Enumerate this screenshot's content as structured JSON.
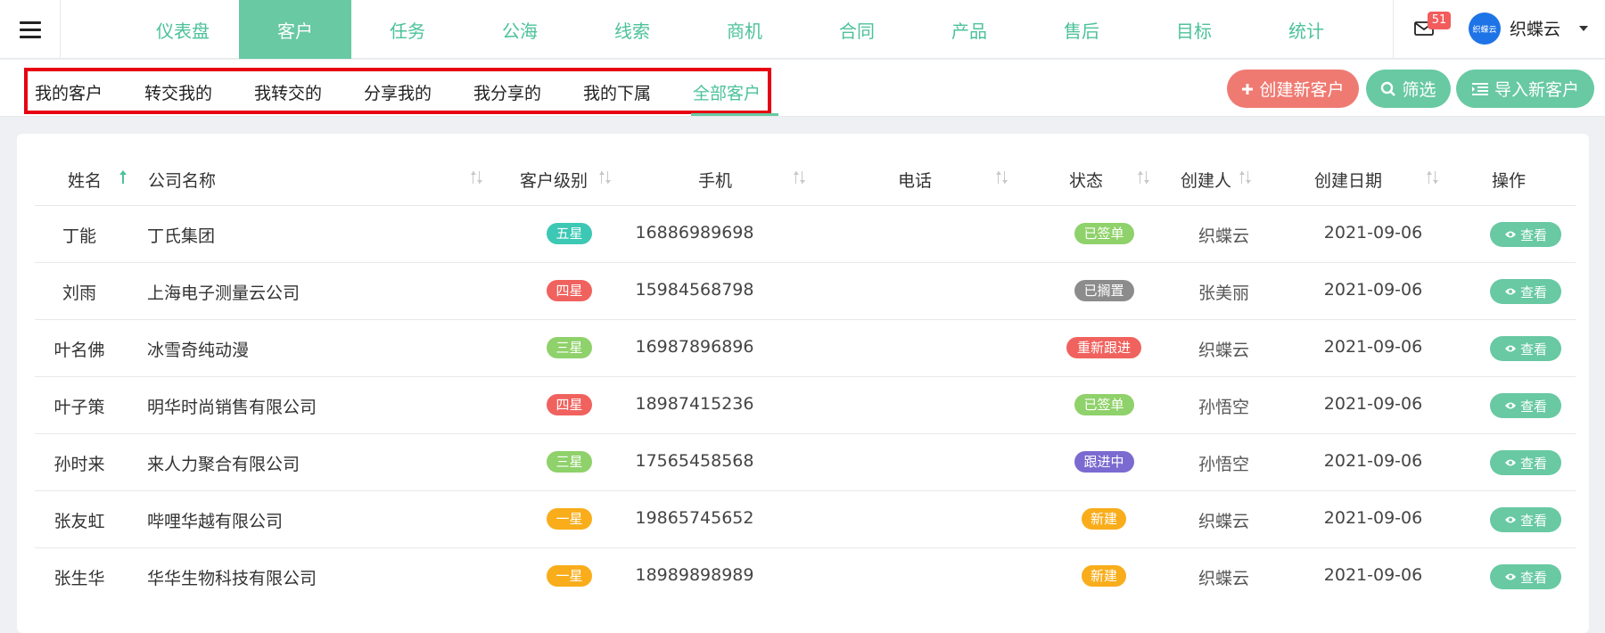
{
  "nav": {
    "items": [
      {
        "label": "仪表盘"
      },
      {
        "label": "客户"
      },
      {
        "label": "任务"
      },
      {
        "label": "公海"
      },
      {
        "label": "线索"
      },
      {
        "label": "商机"
      },
      {
        "label": "合同"
      },
      {
        "label": "产品"
      },
      {
        "label": "售后"
      },
      {
        "label": "目标"
      },
      {
        "label": "统计"
      }
    ],
    "active": "客户"
  },
  "header": {
    "mail_badge": "51",
    "avatar_text": "织蝶云",
    "user_name": "织蝶云"
  },
  "tabs": [
    {
      "label": "我的客户"
    },
    {
      "label": "转交我的"
    },
    {
      "label": "我转交的"
    },
    {
      "label": "分享我的"
    },
    {
      "label": "我分享的"
    },
    {
      "label": "我的下属"
    },
    {
      "label": "全部客户"
    }
  ],
  "active_tab": "全部客户",
  "actions": {
    "create": "创建新客户",
    "filter": "筛选",
    "import": "导入新客户"
  },
  "table": {
    "columns": [
      "姓名",
      "公司名称",
      "客户级别",
      "手机",
      "电话",
      "状态",
      "创建人",
      "创建日期",
      "操作"
    ],
    "rows": [
      {
        "name": "丁能",
        "company": "丁氏集团",
        "level": "五星",
        "level_color": "#3cc8b4",
        "mobile": "16886989698",
        "phone": "",
        "status": "已签单",
        "status_color": "#8fd16a",
        "creator": "织蝶云",
        "date": "2021-09-06",
        "action": "查看"
      },
      {
        "name": "刘雨",
        "company": "上海电子测量云公司",
        "level": "四星",
        "level_color": "#f0625e",
        "mobile": "15984568798",
        "phone": "",
        "status": "已搁置",
        "status_color": "#8c8c8c",
        "creator": "张美丽",
        "date": "2021-09-06",
        "action": "查看"
      },
      {
        "name": "叶名佛",
        "company": "冰雪奇纯动漫",
        "level": "三星",
        "level_color": "#8fd16a",
        "mobile": "16987896896",
        "phone": "",
        "status": "重新跟进",
        "status_color": "#f0625e",
        "creator": "织蝶云",
        "date": "2021-09-06",
        "action": "查看"
      },
      {
        "name": "叶子策",
        "company": "明华时尚销售有限公司",
        "level": "四星",
        "level_color": "#f0625e",
        "mobile": "18987415236",
        "phone": "",
        "status": "已签单",
        "status_color": "#8fd16a",
        "creator": "孙悟空",
        "date": "2021-09-06",
        "action": "查看"
      },
      {
        "name": "孙时来",
        "company": "来人力聚合有限公司",
        "level": "三星",
        "level_color": "#8fd16a",
        "mobile": "17565458568",
        "phone": "",
        "status": "跟进中",
        "status_color": "#7b6ad0",
        "creator": "孙悟空",
        "date": "2021-09-06",
        "action": "查看"
      },
      {
        "name": "张友虹",
        "company": "哔哩华越有限公司",
        "level": "一星",
        "level_color": "#f9ad1b",
        "mobile": "19865745652",
        "phone": "",
        "status": "新建",
        "status_color": "#f9ad1b",
        "creator": "织蝶云",
        "date": "2021-09-06",
        "action": "查看"
      },
      {
        "name": "张生华",
        "company": "华华生物科技有限公司",
        "level": "一星",
        "level_color": "#f9ad1b",
        "mobile": "18989898989",
        "phone": "",
        "status": "新建",
        "status_color": "#f9ad1b",
        "creator": "织蝶云",
        "date": "2021-09-06",
        "action": "查看"
      }
    ]
  },
  "colors": {
    "accent": "#68c9a3",
    "accent_text": "#4cc29a",
    "danger": "#ef7a72",
    "highlight_border": "#e60012"
  }
}
